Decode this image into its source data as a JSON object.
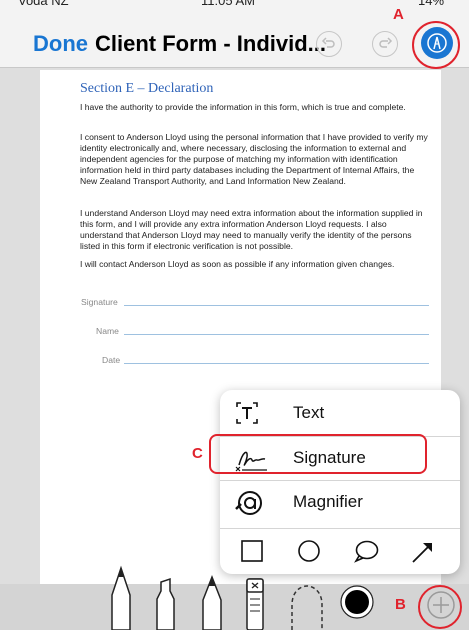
{
  "status_bar": {
    "carrier": "Voda NZ",
    "time": "11:05 AM",
    "battery": "14%"
  },
  "nav": {
    "done_label": "Done",
    "title": "Client Form - Individ..."
  },
  "annotations": {
    "a": "A",
    "b": "B",
    "c": "C"
  },
  "document": {
    "heading": "Section E – Declaration",
    "paragraphs": [
      "I have the authority to provide the information in this form, which is true and complete.",
      "I consent to Anderson Lloyd using the personal information that I have provided to verify my identity electronically and, where necessary, disclosing the information to external and independent agencies for the purpose of matching my information with identification information held in third party databases including the Department of Internal Affairs, the New Zealand Transport Authority, and Land Information New Zealand.",
      "I understand Anderson Lloyd may need extra information about the information supplied in this form, and I will provide any extra information Anderson Lloyd requests. I also understand that Anderson Lloyd may need to manually verify the identity of the persons listed in this form if electronic verification is not possible.",
      "I will contact Anderson Lloyd as soon as possible if any information given changes."
    ],
    "fields": {
      "signature": "Signature",
      "name": "Name",
      "date": "Date"
    }
  },
  "popover": {
    "items": [
      {
        "label": "Text",
        "icon": "text-box-icon"
      },
      {
        "label": "Signature",
        "icon": "signature-icon"
      },
      {
        "label": "Magnifier",
        "icon": "magnifier-icon"
      }
    ],
    "shapes": [
      "square-icon",
      "circle-icon",
      "speech-bubble-icon",
      "arrow-icon"
    ]
  },
  "tools": [
    "pen-icon",
    "highlighter-icon",
    "pencil-icon",
    "eraser-icon",
    "lasso-icon",
    "color-black-icon",
    "add-icon"
  ],
  "colors": {
    "accent": "#1976d2",
    "annotation": "#e0232d",
    "heading": "#2f63b8"
  }
}
